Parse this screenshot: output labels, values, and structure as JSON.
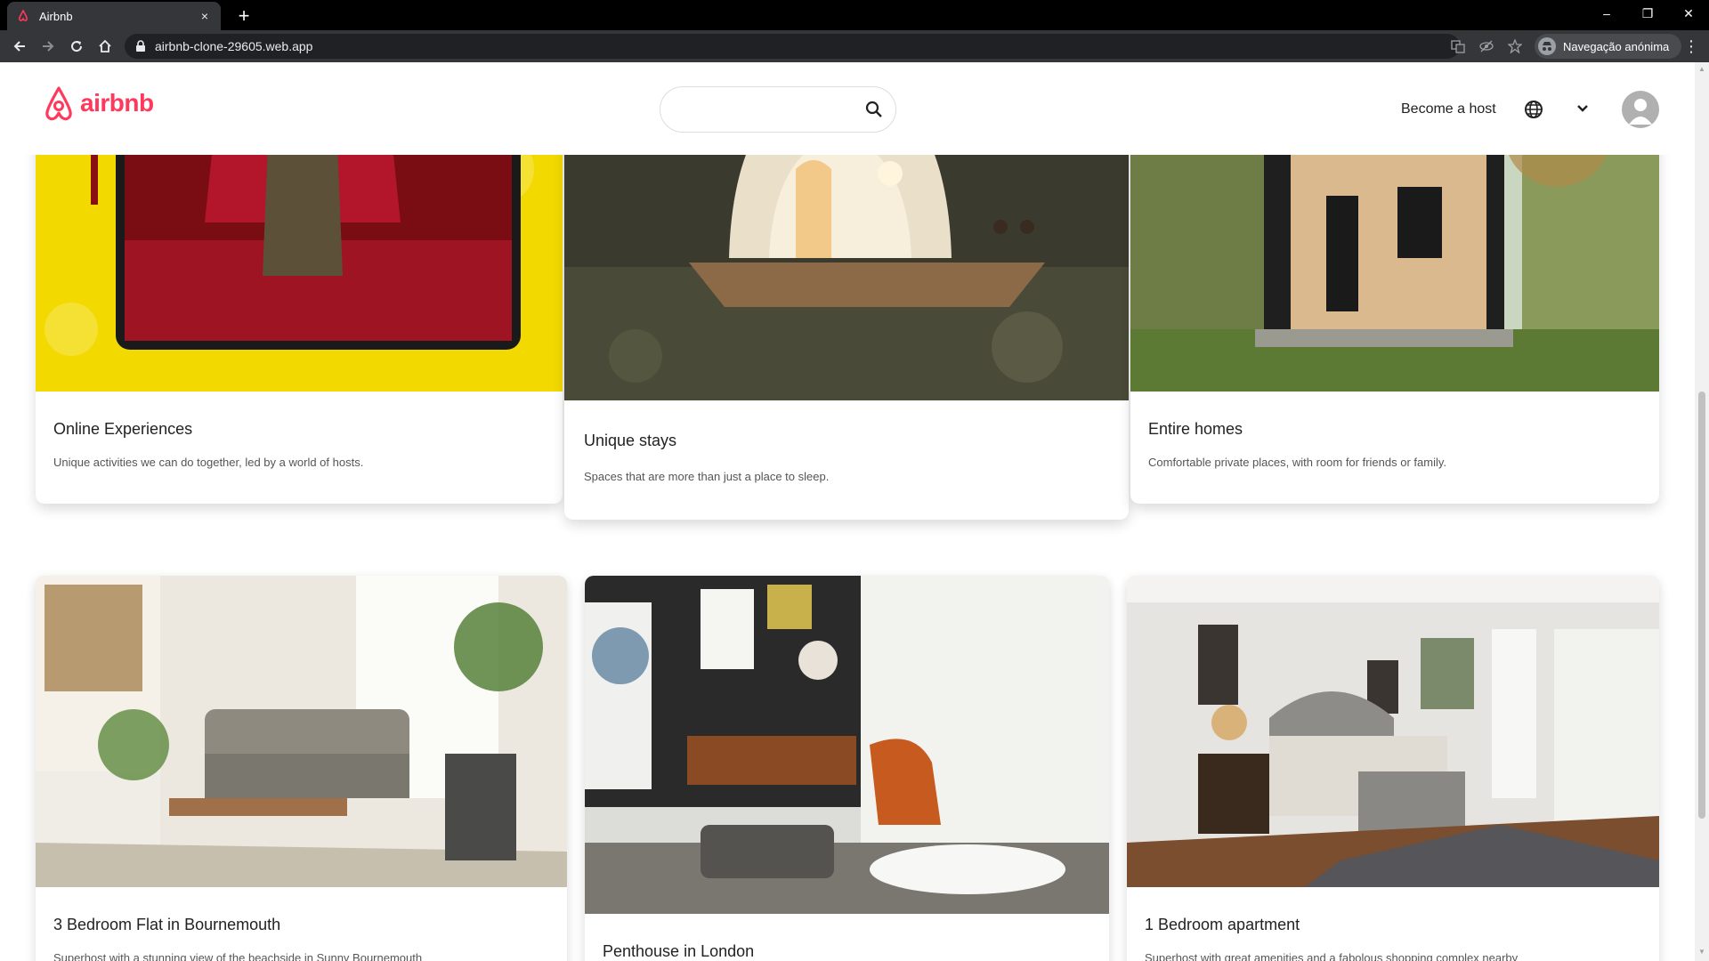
{
  "browser": {
    "tab_title": "Airbnb",
    "new_tab_symbol": "+",
    "close_symbol": "×",
    "url": "airbnb-clone-29605.web.app",
    "profile_label": "Navegação anónima",
    "minimize": "–",
    "maximize": "❐",
    "close_window": "✕",
    "menu": "⋮"
  },
  "header": {
    "logo_text": "airbnb",
    "search_value": "",
    "host_link": "Become a host",
    "brand_color": "#ff385c"
  },
  "categories": [
    {
      "title": "Online Experiences",
      "subtitle": "Unique activities we can do together, led by a world of hosts."
    },
    {
      "title": "Unique stays",
      "subtitle": "Spaces that are more than just a place to sleep."
    },
    {
      "title": "Entire homes",
      "subtitle": "Comfortable private places, with room for friends or family."
    }
  ],
  "listings": [
    {
      "title": "3 Bedroom Flat in Bournemouth",
      "subtitle": "Superhost with a stunning view of the beachside in Sunny Bournemouth"
    },
    {
      "title": "Penthouse in London",
      "subtitle": ""
    },
    {
      "title": "1 Bedroom apartment",
      "subtitle": "Superhost with great amenities and a fabolous shopping complex nearby"
    }
  ]
}
